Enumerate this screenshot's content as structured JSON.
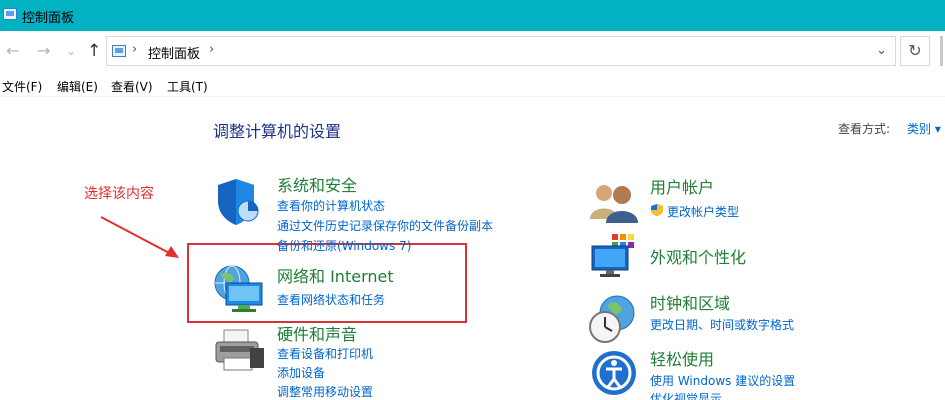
{
  "window": {
    "title": "控制面板"
  },
  "nav": {
    "back": "←",
    "forward": "→",
    "recent": "⌄",
    "up": "↑"
  },
  "address": {
    "separator": "›",
    "path_label": "控制面板",
    "trailing_sep": "›",
    "dropdown": "⌄"
  },
  "refresh": "↻",
  "menu": [
    {
      "label": "文件(F)"
    },
    {
      "label": "编辑(E)"
    },
    {
      "label": "查看(V)"
    },
    {
      "label": "工具(T)"
    }
  ],
  "page": {
    "title": "调整计算机的设置",
    "view_by_label": "查看方式:",
    "view_by_value": "类别 ▾"
  },
  "annotation": {
    "text": "选择该内容",
    "color": "#e0302e"
  },
  "categories_left": [
    {
      "title": "系统和安全",
      "links": [
        "查看你的计算机状态",
        "通过文件历史记录保存你的文件备份副本",
        "备份和还原(Windows 7)"
      ]
    },
    {
      "title": "网络和 Internet",
      "links": [
        "查看网络状态和任务"
      ]
    },
    {
      "title": "硬件和声音",
      "links": [
        "查看设备和打印机",
        "添加设备",
        "调整常用移动设置"
      ]
    }
  ],
  "categories_right": [
    {
      "title": "用户帐户",
      "links": [
        "更改帐户类型"
      ]
    },
    {
      "title": "外观和个性化",
      "links": []
    },
    {
      "title": "时钟和区域",
      "links": [
        "更改日期、时间或数字格式"
      ]
    },
    {
      "title": "轻松使用",
      "links": [
        "使用 Windows 建议的设置",
        "优化视觉显示"
      ]
    }
  ],
  "colors": {
    "titlebar": "#00b2c2",
    "category_title": "#1e7e34",
    "link": "#0066cc",
    "heading": "#1e3287",
    "highlight": "#d93237"
  }
}
